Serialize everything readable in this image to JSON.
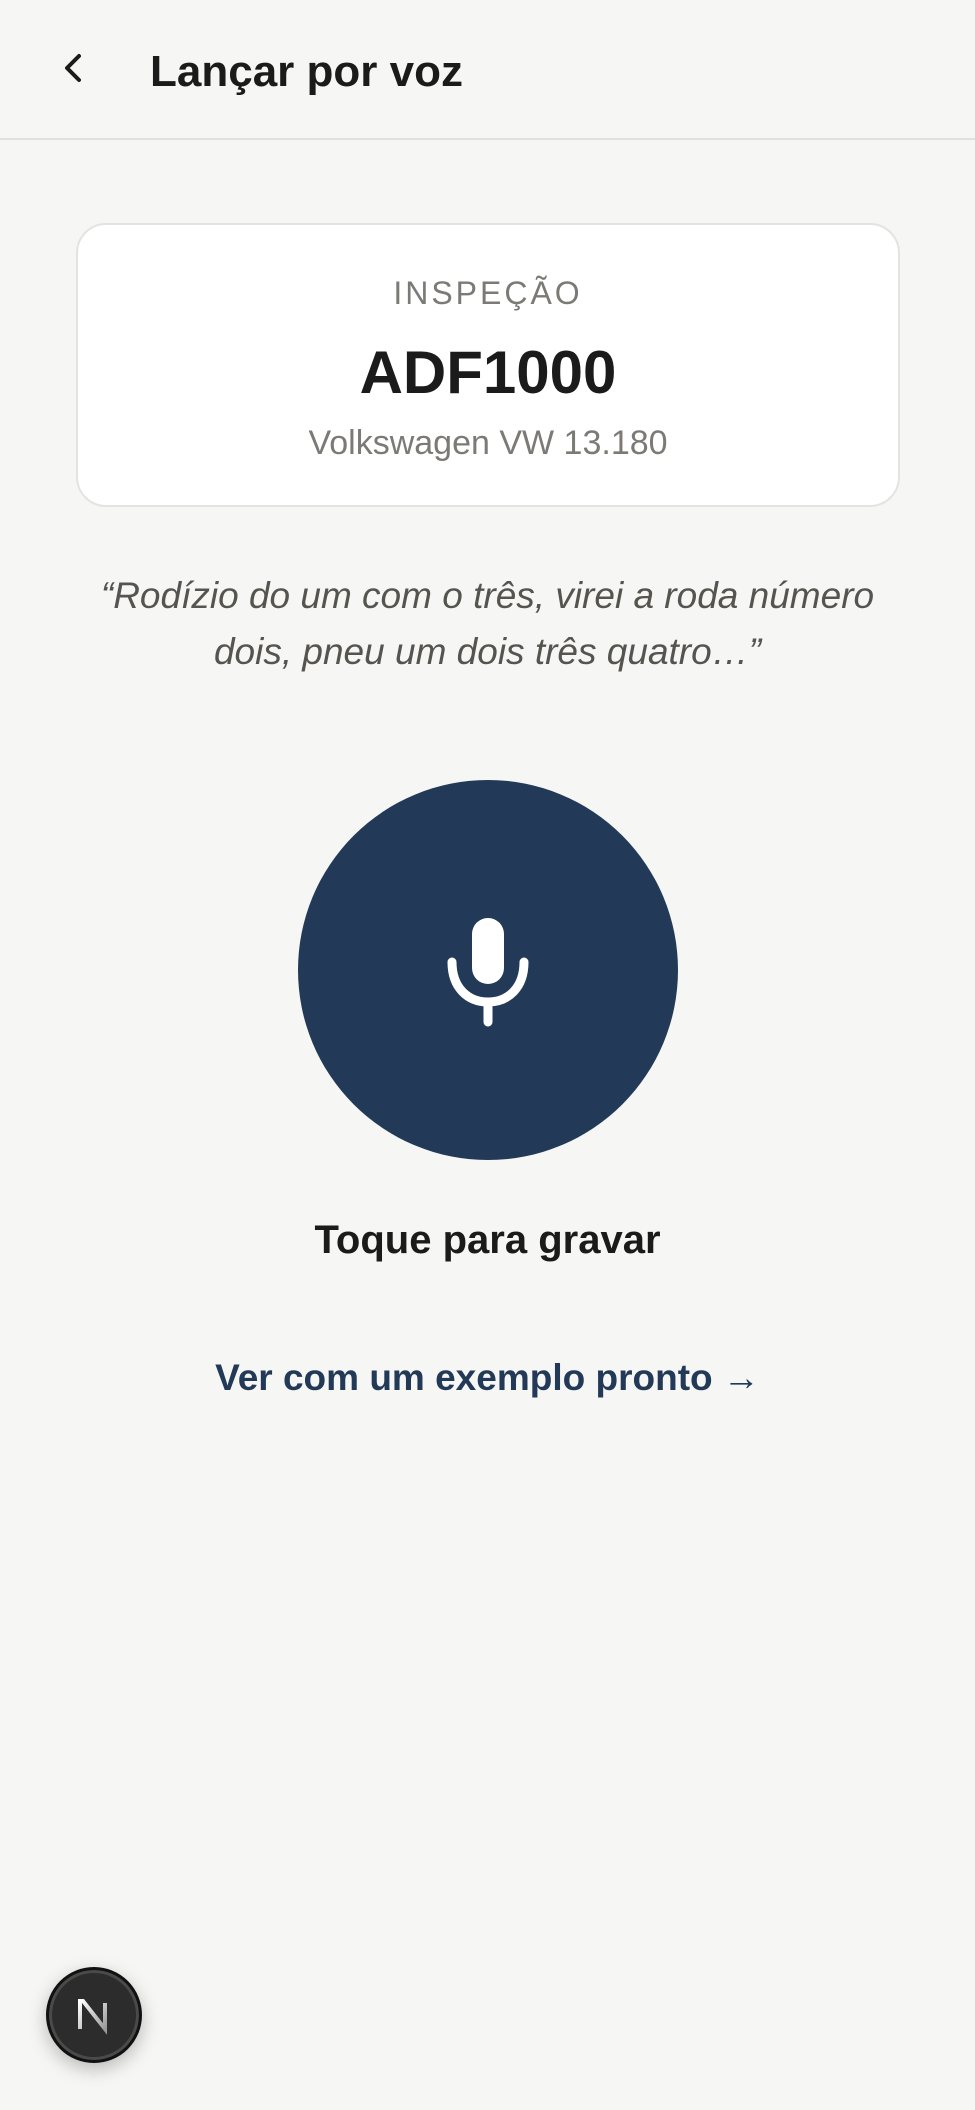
{
  "header": {
    "back_icon": "chevron-left-icon",
    "title": "Lançar por voz"
  },
  "card": {
    "eyebrow": "INSPEÇÃO",
    "plate": "ADF1000",
    "model": "Volkswagen VW 13.180"
  },
  "quote": "“Rodízio do um com o três, virei a roda número dois, pneu um dois três quatro…”",
  "mic": {
    "icon": "microphone-icon",
    "label": "Toque para gravar"
  },
  "example_link": "Ver com um exemplo pronto →",
  "badge": {
    "icon": "n-logo-icon",
    "letter": "N"
  },
  "colors": {
    "background": "#f6f6f4",
    "accent": "#223a57",
    "text": "#1b1b1b",
    "muted": "#7b7a75"
  }
}
